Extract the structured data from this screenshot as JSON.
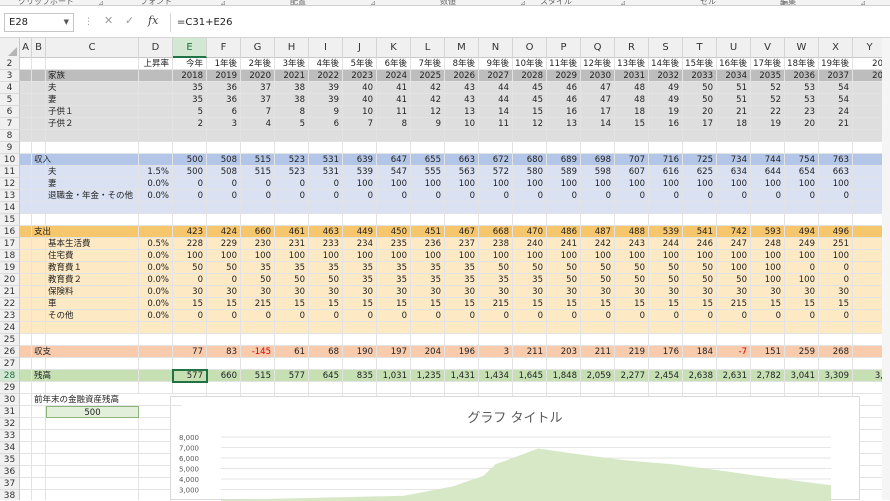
{
  "ribbon": {
    "groups": [
      "クリップボード",
      "フォント",
      "配置",
      "数値",
      "スタイル",
      "セル",
      "編集"
    ]
  },
  "formula_bar": {
    "name_box": "E28",
    "formula": "=C31+E26",
    "fx_label": "fx",
    "cancel": "✕",
    "enter": "✓"
  },
  "columns": {
    "letters": [
      "A",
      "B",
      "C",
      "D",
      "E",
      "F",
      "G",
      "H",
      "I",
      "J",
      "K",
      "L",
      "M",
      "N",
      "O",
      "P",
      "Q",
      "R",
      "S",
      "T",
      "U",
      "V",
      "W",
      "X",
      "Y"
    ],
    "selected": "E"
  },
  "header": {
    "rate_label": "上昇率",
    "years_after": [
      "今年",
      "1年後",
      "2年後",
      "3年後",
      "4年後",
      "5年後",
      "6年後",
      "7年後",
      "8年後",
      "9年後",
      "10年後",
      "11年後",
      "12年後",
      "13年後",
      "14年後",
      "15年後",
      "16年後",
      "17年後",
      "18年後",
      "19年後",
      "20"
    ],
    "years": [
      "2018",
      "2019",
      "2020",
      "2021",
      "2022",
      "2023",
      "2024",
      "2025",
      "2026",
      "2027",
      "2028",
      "2029",
      "2030",
      "2031",
      "2032",
      "2033",
      "2034",
      "2035",
      "2036",
      "2037",
      "20"
    ]
  },
  "rows": [
    {
      "n": "2",
      "type": "hdr2"
    },
    {
      "n": "3",
      "type": "hdr3",
      "label": "家族"
    },
    {
      "n": "4",
      "label": "夫",
      "rate": "",
      "vals": [
        "35",
        "36",
        "37",
        "38",
        "39",
        "40",
        "41",
        "42",
        "43",
        "44",
        "45",
        "46",
        "47",
        "48",
        "49",
        "50",
        "51",
        "52",
        "53",
        "54",
        ""
      ],
      "bg": "lgray"
    },
    {
      "n": "5",
      "label": "妻",
      "rate": "",
      "vals": [
        "35",
        "36",
        "37",
        "38",
        "39",
        "40",
        "41",
        "42",
        "43",
        "44",
        "45",
        "46",
        "47",
        "48",
        "49",
        "50",
        "51",
        "52",
        "53",
        "54",
        ""
      ],
      "bg": "lgray"
    },
    {
      "n": "6",
      "label": "子供１",
      "rate": "",
      "vals": [
        "5",
        "6",
        "7",
        "8",
        "9",
        "10",
        "11",
        "12",
        "13",
        "14",
        "15",
        "16",
        "17",
        "18",
        "19",
        "20",
        "21",
        "22",
        "23",
        "24",
        ""
      ],
      "bg": "lgray"
    },
    {
      "n": "7",
      "label": "子供２",
      "rate": "",
      "vals": [
        "2",
        "3",
        "4",
        "5",
        "6",
        "7",
        "8",
        "9",
        "10",
        "11",
        "12",
        "13",
        "14",
        "15",
        "16",
        "17",
        "18",
        "19",
        "20",
        "21",
        ""
      ],
      "bg": "lgray"
    },
    {
      "n": "8",
      "type": "blank",
      "bg": "lgray"
    },
    {
      "n": "9",
      "type": "blank",
      "bg": ""
    },
    {
      "n": "10",
      "section": "収入",
      "rate": "",
      "vals": [
        "500",
        "508",
        "515",
        "523",
        "531",
        "639",
        "647",
        "655",
        "663",
        "672",
        "680",
        "689",
        "698",
        "707",
        "716",
        "725",
        "734",
        "744",
        "754",
        "763",
        ""
      ],
      "bg": "blue"
    },
    {
      "n": "11",
      "label": "夫",
      "rate": "1.5%",
      "vals": [
        "500",
        "508",
        "515",
        "523",
        "531",
        "539",
        "547",
        "555",
        "563",
        "572",
        "580",
        "589",
        "598",
        "607",
        "616",
        "625",
        "634",
        "644",
        "654",
        "663",
        ""
      ],
      "bg": "lblue"
    },
    {
      "n": "12",
      "label": "妻",
      "rate": "0.0%",
      "vals": [
        "0",
        "0",
        "0",
        "0",
        "0",
        "100",
        "100",
        "100",
        "100",
        "100",
        "100",
        "100",
        "100",
        "100",
        "100",
        "100",
        "100",
        "100",
        "100",
        "100",
        ""
      ],
      "bg": "lblue"
    },
    {
      "n": "13",
      "label": "退職金・年金・その他",
      "rate": "0.0%",
      "vals": [
        "0",
        "0",
        "0",
        "0",
        "0",
        "0",
        "0",
        "0",
        "0",
        "0",
        "0",
        "0",
        "0",
        "0",
        "0",
        "0",
        "0",
        "0",
        "0",
        "0",
        ""
      ],
      "bg": "lblue"
    },
    {
      "n": "14",
      "type": "blank",
      "bg": "lblue"
    },
    {
      "n": "15",
      "type": "blank",
      "bg": ""
    },
    {
      "n": "16",
      "section": "支出",
      "rate": "",
      "vals": [
        "423",
        "424",
        "660",
        "461",
        "463",
        "449",
        "450",
        "451",
        "467",
        "668",
        "470",
        "486",
        "487",
        "488",
        "539",
        "541",
        "742",
        "593",
        "494",
        "496",
        ""
      ],
      "bg": "orange"
    },
    {
      "n": "17",
      "label": "基本生活費",
      "rate": "0.5%",
      "vals": [
        "228",
        "229",
        "230",
        "231",
        "233",
        "234",
        "235",
        "236",
        "237",
        "238",
        "240",
        "241",
        "242",
        "243",
        "244",
        "246",
        "247",
        "248",
        "249",
        "251",
        ""
      ],
      "bg": "lorange"
    },
    {
      "n": "18",
      "label": "住宅費",
      "rate": "0.0%",
      "vals": [
        "100",
        "100",
        "100",
        "100",
        "100",
        "100",
        "100",
        "100",
        "100",
        "100",
        "100",
        "100",
        "100",
        "100",
        "100",
        "100",
        "100",
        "100",
        "100",
        "100",
        ""
      ],
      "bg": "lorange"
    },
    {
      "n": "19",
      "label": "教育費１",
      "rate": "0.0%",
      "vals": [
        "50",
        "50",
        "35",
        "35",
        "35",
        "35",
        "35",
        "35",
        "35",
        "50",
        "50",
        "50",
        "50",
        "50",
        "50",
        "50",
        "100",
        "100",
        "0",
        "0",
        ""
      ],
      "bg": "lorange"
    },
    {
      "n": "20",
      "label": "教育費２",
      "rate": "0.0%",
      "vals": [
        "0",
        "0",
        "50",
        "50",
        "50",
        "35",
        "35",
        "35",
        "35",
        "35",
        "35",
        "50",
        "50",
        "50",
        "50",
        "50",
        "50",
        "100",
        "100",
        "0",
        ""
      ],
      "bg": "lorange"
    },
    {
      "n": "21",
      "label": "保険料",
      "rate": "0.0%",
      "vals": [
        "30",
        "30",
        "30",
        "30",
        "30",
        "30",
        "30",
        "30",
        "30",
        "30",
        "30",
        "30",
        "30",
        "30",
        "30",
        "30",
        "30",
        "30",
        "30",
        "30",
        ""
      ],
      "bg": "lorange"
    },
    {
      "n": "22",
      "label": "車",
      "rate": "0.0%",
      "vals": [
        "15",
        "15",
        "215",
        "15",
        "15",
        "15",
        "15",
        "15",
        "15",
        "215",
        "15",
        "15",
        "15",
        "15",
        "15",
        "15",
        "215",
        "15",
        "15",
        "15",
        ""
      ],
      "bg": "lorange"
    },
    {
      "n": "23",
      "label": "その他",
      "rate": "0.0%",
      "vals": [
        "0",
        "0",
        "0",
        "0",
        "0",
        "0",
        "0",
        "0",
        "0",
        "0",
        "0",
        "0",
        "0",
        "0",
        "0",
        "0",
        "0",
        "0",
        "0",
        "0",
        ""
      ],
      "bg": "lorange"
    },
    {
      "n": "24",
      "type": "blank",
      "bg": "lorange"
    },
    {
      "n": "25",
      "type": "blank",
      "bg": ""
    },
    {
      "n": "26",
      "section": "収支",
      "rate": "",
      "vals": [
        "77",
        "83",
        "-145",
        "61",
        "68",
        "190",
        "197",
        "204",
        "196",
        "3",
        "211",
        "203",
        "211",
        "219",
        "176",
        "184",
        "-7",
        "151",
        "259",
        "268",
        ""
      ],
      "bg": "pink"
    },
    {
      "n": "27",
      "type": "blank",
      "bg": ""
    },
    {
      "n": "28",
      "section": "残高",
      "rate": "",
      "vals": [
        "577",
        "660",
        "515",
        "577",
        "645",
        "835",
        "1,031",
        "1,235",
        "1,431",
        "1,434",
        "1,645",
        "1,848",
        "2,059",
        "2,277",
        "2,454",
        "2,638",
        "2,631",
        "2,782",
        "3,041",
        "3,309",
        "3,"
      ],
      "bg": "green"
    },
    {
      "n": "29",
      "type": "blank",
      "bg": ""
    },
    {
      "n": "30",
      "type": "note",
      "label": "前年末の金融資産残高"
    },
    {
      "n": "31",
      "type": "input",
      "value": "500"
    },
    {
      "n": "32",
      "type": "blank",
      "bg": ""
    },
    {
      "n": "33",
      "type": "blank",
      "bg": ""
    },
    {
      "n": "34",
      "type": "blank",
      "bg": ""
    },
    {
      "n": "35",
      "type": "blank",
      "bg": ""
    },
    {
      "n": "36",
      "type": "blank",
      "bg": ""
    },
    {
      "n": "37",
      "type": "blank",
      "bg": ""
    },
    {
      "n": "38",
      "type": "blank",
      "bg": ""
    }
  ],
  "chart_data": {
    "type": "area",
    "title": "グラフ タイトル",
    "yticks": [
      "8,000",
      "7,000",
      "6,000",
      "5,000",
      "4,000",
      "3,000"
    ],
    "ylim": [
      3000,
      8000
    ],
    "x_fraction": [
      0.0,
      0.3,
      0.38,
      0.43,
      0.45,
      0.52,
      0.58,
      0.66,
      0.74,
      0.82,
      0.88,
      1.0
    ],
    "values": [
      2000,
      2400,
      3300,
      4300,
      5400,
      6900,
      6400,
      5800,
      5400,
      4800,
      4300,
      3400
    ],
    "colors": {
      "fill": "#d7e8c7"
    }
  }
}
